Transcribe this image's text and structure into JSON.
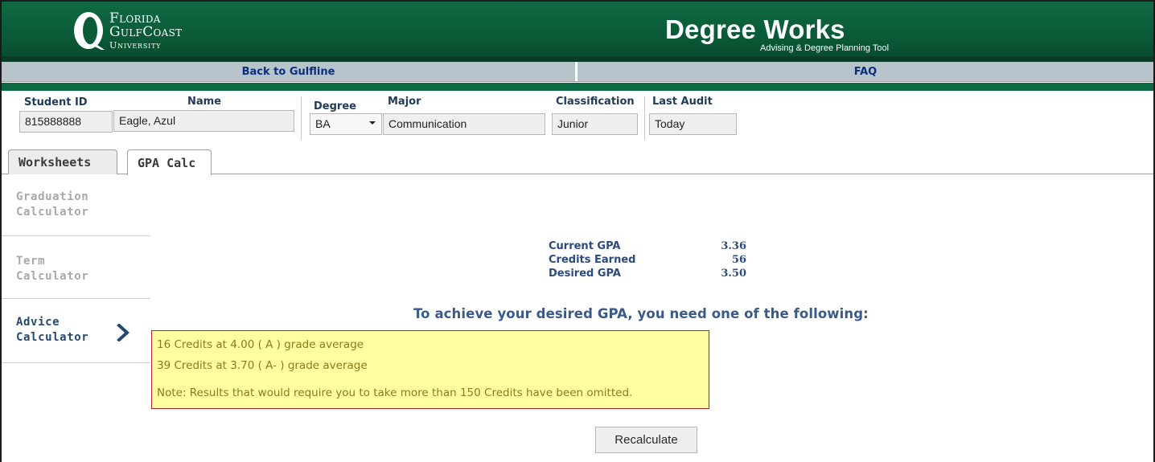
{
  "header": {
    "logo": {
      "word1": "Florida",
      "word2": "GulfCoast",
      "word3": "University"
    },
    "app_title": "Degree Works",
    "app_subtitle": "Advising & Degree Planning Tool",
    "colors": {
      "banner": "#0a5b38",
      "nav": "#b8c4cc",
      "link": "#0b2f7a"
    }
  },
  "nav": {
    "back_label": "Back to Gulfline",
    "faq_label": "FAQ"
  },
  "student": {
    "id_label": "Student ID",
    "id_value": "815888888",
    "name_label": "Name",
    "name_value": "Eagle, Azul",
    "degree_label": "Degree",
    "degree_value": "BA",
    "major_label": "Major",
    "major_value": "Communication",
    "classification_label": "Classification",
    "classification_value": "Junior",
    "last_audit_label": "Last Audit",
    "last_audit_value": "Today"
  },
  "tabs": [
    {
      "label": "Worksheets",
      "active": false
    },
    {
      "label": "GPA Calc",
      "active": true
    }
  ],
  "side_menu": {
    "items": [
      {
        "line1": "Graduation",
        "line2": "Calculator",
        "active": false
      },
      {
        "line1": "Term",
        "line2": "Calculator",
        "active": false
      },
      {
        "line1": "Advice",
        "line2": "Calculator",
        "active": true
      }
    ],
    "active_icon": "chevron-right-icon"
  },
  "gpa_summary": {
    "current_gpa_label": "Current GPA",
    "current_gpa_value": "3.36",
    "credits_earned_label": "Credits Earned",
    "credits_earned_value": "56",
    "desired_gpa_label": "Desired GPA",
    "desired_gpa_value": "3.50"
  },
  "advice": {
    "heading": "To achieve your desired GPA, you need one of the following:",
    "results": [
      "16 Credits at 4.00 ( A ) grade average",
      "39 Credits at 3.70 ( A- ) grade average"
    ],
    "note": "Note: Results that would require you to take more than 150 Credits have been omitted."
  },
  "actions": {
    "recalculate_label": "Recalculate"
  }
}
